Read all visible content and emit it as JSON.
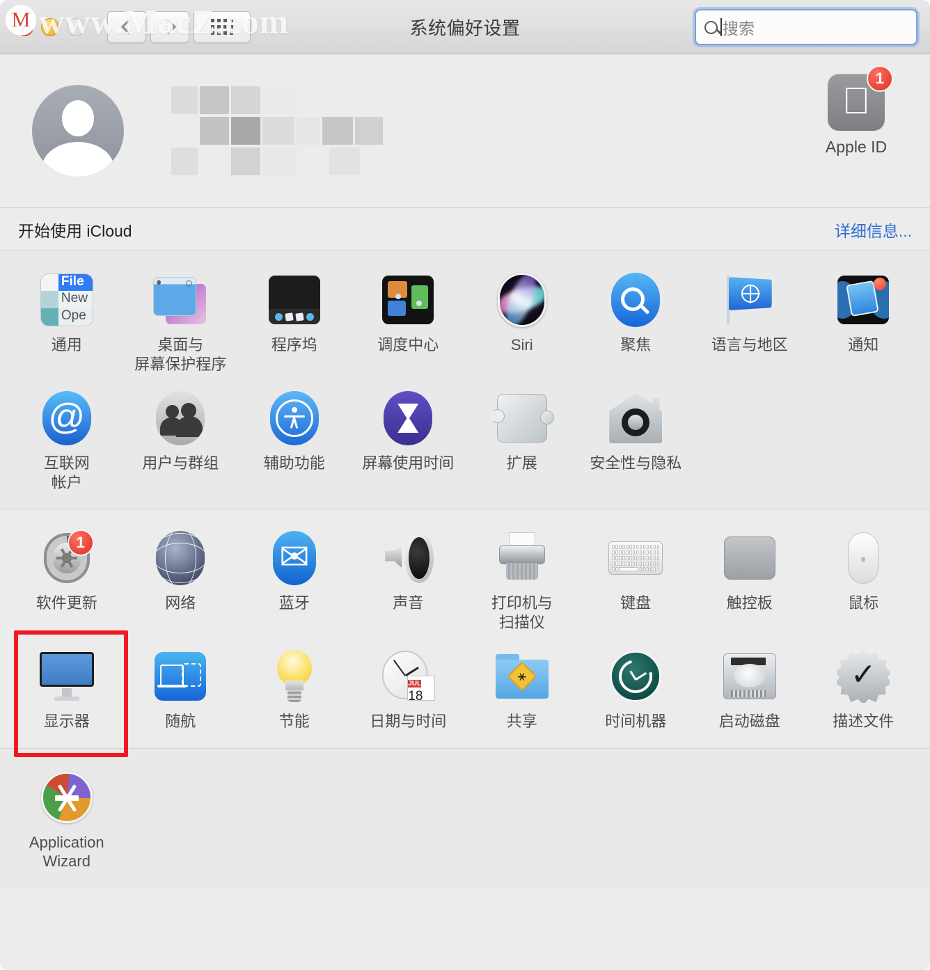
{
  "window": {
    "title": "系统偏好设置",
    "watermark": "www.MacZ.com",
    "watermark_logo": "M"
  },
  "toolbar": {
    "traffic_lights": [
      "close",
      "minimize",
      "zoom"
    ],
    "back_label": "后退",
    "forward_label": "前进",
    "showall_label": "显示全部",
    "search": {
      "placeholder": "搜索",
      "value": "",
      "icon": "search-icon",
      "focused": true,
      "focus_color": "#7aa0e0"
    }
  },
  "account": {
    "name_redacted": true,
    "avatar_icon": "person-placeholder-icon",
    "apple_id": {
      "label": "Apple ID",
      "icon": "apple-logo-icon",
      "badge": "1",
      "badge_color": "#dd2f22"
    }
  },
  "icloud_banner": {
    "text": "开始使用 iCloud",
    "link": "详细信息...",
    "link_color": "#2f6fd0"
  },
  "highlight": {
    "target": "显示器",
    "color": "#ef1b22"
  },
  "sections": [
    {
      "id": "section-personal",
      "rows": [
        [
          {
            "label": "通用",
            "icon": "general-icon",
            "badge": null
          },
          {
            "label": "桌面与\n屏幕保护程序",
            "icon": "desktop-screensaver-icon",
            "badge": null
          },
          {
            "label": "程序坞",
            "icon": "dock-icon",
            "badge": null
          },
          {
            "label": "调度中心",
            "icon": "mission-control-icon",
            "badge": null
          },
          {
            "label": "Siri",
            "icon": "siri-icon",
            "badge": null
          },
          {
            "label": "聚焦",
            "icon": "spotlight-icon",
            "badge": null
          },
          {
            "label": "语言与地区",
            "icon": "language-region-icon",
            "badge": null
          },
          {
            "label": "通知",
            "icon": "notifications-icon",
            "badge": null
          }
        ],
        [
          {
            "label": "互联网\n帐户",
            "icon": "internet-accounts-icon",
            "badge": null
          },
          {
            "label": "用户与群组",
            "icon": "users-groups-icon",
            "badge": null
          },
          {
            "label": "辅助功能",
            "icon": "accessibility-icon",
            "badge": null
          },
          {
            "label": "屏幕使用时间",
            "icon": "screen-time-icon",
            "badge": null
          },
          {
            "label": "扩展",
            "icon": "extensions-icon",
            "badge": null
          },
          {
            "label": "安全性与隐私",
            "icon": "security-privacy-icon",
            "badge": null
          }
        ]
      ]
    },
    {
      "id": "section-hardware",
      "rows": [
        [
          {
            "label": "软件更新",
            "icon": "software-update-icon",
            "badge": "1"
          },
          {
            "label": "网络",
            "icon": "network-icon",
            "badge": null
          },
          {
            "label": "蓝牙",
            "icon": "bluetooth-icon",
            "badge": null
          },
          {
            "label": "声音",
            "icon": "sound-icon",
            "badge": null
          },
          {
            "label": "打印机与\n扫描仪",
            "icon": "printers-scanners-icon",
            "badge": null
          },
          {
            "label": "键盘",
            "icon": "keyboard-icon",
            "badge": null
          },
          {
            "label": "触控板",
            "icon": "trackpad-icon",
            "badge": null
          },
          {
            "label": "鼠标",
            "icon": "mouse-icon",
            "badge": null
          }
        ],
        [
          {
            "label": "显示器",
            "icon": "displays-icon",
            "badge": null,
            "highlighted": true
          },
          {
            "label": "随航",
            "icon": "sidecar-icon",
            "badge": null
          },
          {
            "label": "节能",
            "icon": "energy-saver-icon",
            "badge": null
          },
          {
            "label": "日期与时间",
            "icon": "date-time-icon",
            "badge": null,
            "calendar": {
              "month": "JUL",
              "day": "18"
            }
          },
          {
            "label": "共享",
            "icon": "sharing-icon",
            "badge": null
          },
          {
            "label": "时间机器",
            "icon": "time-machine-icon",
            "badge": null
          },
          {
            "label": "启动磁盘",
            "icon": "startup-disk-icon",
            "badge": null
          },
          {
            "label": "描述文件",
            "icon": "profiles-icon",
            "badge": null
          }
        ]
      ]
    },
    {
      "id": "section-third-party",
      "rows": [
        [
          {
            "label": "Application\nWizard",
            "icon": "application-wizard-icon",
            "badge": null
          }
        ]
      ]
    }
  ],
  "general_icon_text": {
    "menu": "File",
    "item1": "New",
    "item2": "Ope"
  }
}
